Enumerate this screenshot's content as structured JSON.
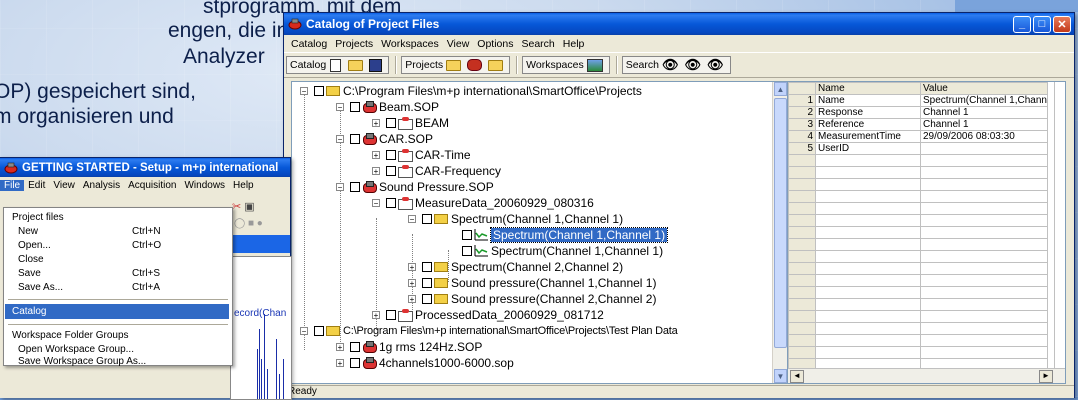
{
  "slide": {
    "lines": [
      "stprogramm, mit dem",
      "engen, die in",
      "Analyzer",
      "OP) gespeichert sind,",
      "m organisieren und"
    ]
  },
  "catalog": {
    "title": "Catalog of Project Files",
    "menu": [
      "Catalog",
      "Projects",
      "Workspaces",
      "View",
      "Options",
      "Search",
      "Help"
    ],
    "toolbar": {
      "catalog_label": "Catalog",
      "projects_label": "Projects",
      "workspaces_label": "Workspaces",
      "search_label": "Search"
    },
    "tree": [
      {
        "label": "C:\\Program Files\\m+p international\\SmartOffice\\Projects",
        "icon": "folder"
      },
      {
        "label": "Beam.SOP",
        "icon": "project"
      },
      {
        "label": "BEAM",
        "icon": "measurement"
      },
      {
        "label": "CAR.SOP",
        "icon": "project"
      },
      {
        "label": "CAR-Time",
        "icon": "measurement"
      },
      {
        "label": "CAR-Frequency",
        "icon": "measurement"
      },
      {
        "label": "Sound Pressure.SOP",
        "icon": "project"
      },
      {
        "label": "MeasureData_20060929_080316",
        "icon": "measurement"
      },
      {
        "label": "Spectrum(Channel 1,Channel 1)",
        "icon": "folder"
      },
      {
        "label": "Spectrum(Channel 1,Channel 1)",
        "icon": "spectrum",
        "selected": true
      },
      {
        "label": "Spectrum(Channel 1,Channel 1)",
        "icon": "spectrum"
      },
      {
        "label": "Spectrum(Channel 2,Channel 2)",
        "icon": "folder"
      },
      {
        "label": "Sound pressure(Channel 1,Channel 1)",
        "icon": "folder"
      },
      {
        "label": "Sound pressure(Channel 2,Channel 2)",
        "icon": "folder"
      },
      {
        "label": "ProcessedData_20060929_081712",
        "icon": "measurement"
      },
      {
        "label": "C:\\Program Files\\m+p international\\SmartOffice\\Projects\\Test Plan Data",
        "icon": "folder"
      },
      {
        "label": "1g rms 124Hz.SOP",
        "icon": "project"
      },
      {
        "label": "4channels1000-6000.sop",
        "icon": "project"
      }
    ],
    "grid": {
      "headers": {
        "name": "Name",
        "value": "Value"
      },
      "rows": [
        {
          "n": "1",
          "name": "Name",
          "value": "Spectrum(Channel 1,Channe"
        },
        {
          "n": "2",
          "name": "Response",
          "value": "Channel 1"
        },
        {
          "n": "3",
          "name": "Reference",
          "value": "Channel 1"
        },
        {
          "n": "4",
          "name": "MeasurementTime",
          "value": "29/09/2006 08:03:30"
        },
        {
          "n": "5",
          "name": "UserID",
          "value": ""
        }
      ]
    },
    "status": "Ready"
  },
  "getting_started": {
    "title": "GETTING STARTED - Setup - m+p international",
    "menu": [
      "File",
      "Edit",
      "View",
      "Analysis",
      "Acquisition",
      "Windows",
      "Help"
    ],
    "file_menu": {
      "project_files": "Project files",
      "new": "New",
      "new_sc": "Ctrl+N",
      "open": "Open...",
      "open_sc": "Ctrl+O",
      "close": "Close",
      "save": "Save",
      "save_sc": "Ctrl+S",
      "save_as": "Save As...",
      "save_as_sc": "Ctrl+A",
      "catalog": "Catalog",
      "workspace_groups": "Workspace Folder Groups",
      "open_group": "Open Workspace Group...",
      "save_group": "Save Workspace Group As..."
    },
    "record_text": "ecord(Chan"
  }
}
